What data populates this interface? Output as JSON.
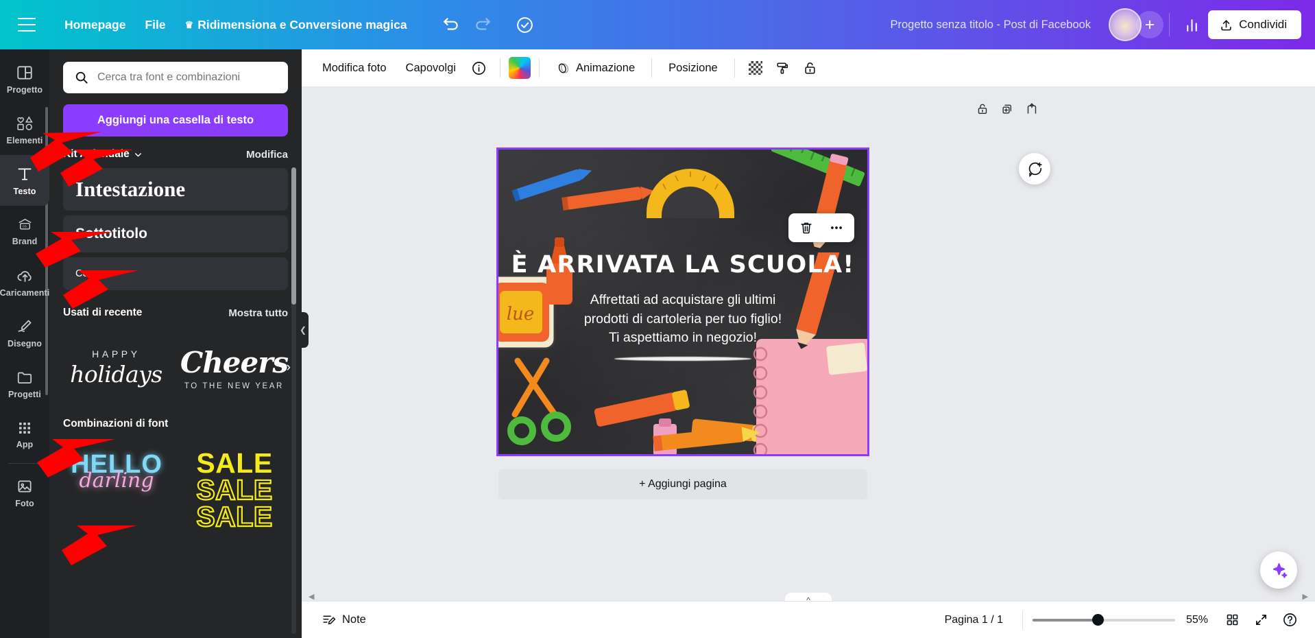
{
  "header": {
    "menu_icon": "hamburger-icon",
    "nav": [
      {
        "label": "Homepage",
        "icon": null
      },
      {
        "label": "File",
        "icon": null
      },
      {
        "label": "Ridimensiona e Conversione magica",
        "icon": "crown-icon"
      }
    ],
    "undo_icon": "undo-icon",
    "redo_icon": "redo-icon",
    "cloud_icon": "cloud-check-icon",
    "doc_title": "Progetto senza titolo - Post di Facebook",
    "add_collaborator_label": "+",
    "stats_icon": "bar-chart-icon",
    "share_label": "Condividi",
    "share_icon": "upload-icon"
  },
  "rail": {
    "items": [
      {
        "label": "Progetto",
        "icon": "layout-icon",
        "active": false
      },
      {
        "label": "Elementi",
        "icon": "shapes-icon",
        "active": false
      },
      {
        "label": "Testo",
        "icon": "text-t-icon",
        "active": true
      },
      {
        "label": "Brand",
        "icon": "brand-card-icon",
        "active": false
      },
      {
        "label": "Caricamenti",
        "icon": "upload-cloud-icon",
        "active": false
      },
      {
        "label": "Disegno",
        "icon": "pen-icon",
        "active": false
      },
      {
        "label": "Progetti",
        "icon": "folder-icon",
        "active": false
      },
      {
        "label": "App",
        "icon": "grid-dots-icon",
        "active": false
      },
      {
        "label": "Foto",
        "icon": "image-icon",
        "active": false
      }
    ]
  },
  "panel": {
    "search": {
      "placeholder": "Cerca tra font e combinazioni",
      "value": "",
      "icon": "search-icon"
    },
    "add_text_button": "Aggiungi una casella di testo",
    "brand_kit": {
      "title": "Kit Aziendale",
      "chevron": "chevron-down-icon",
      "edit_label": "Modifica"
    },
    "styles": [
      {
        "label": "Intestazione",
        "variant": "h1"
      },
      {
        "label": "Sottotitolo",
        "variant": "h2"
      },
      {
        "label": "Corpo",
        "variant": "h3"
      }
    ],
    "recent": {
      "title": "Usati di recente",
      "show_all": "Mostra tutto",
      "tiles": [
        {
          "top": "HAPPY",
          "main": "holidays",
          "bottom": ""
        },
        {
          "top": "",
          "main": "Cheers",
          "bottom": "TO THE NEW YEAR"
        }
      ]
    },
    "combos": {
      "title": "Combinazioni di font",
      "tiles": [
        {
          "line1": "HELLO",
          "line2": "darling"
        },
        {
          "line1": "SALE",
          "line2": "SALE",
          "line3": "SALE"
        }
      ]
    }
  },
  "toolbar": {
    "items": [
      {
        "label": "Modifica foto",
        "type": "text"
      },
      {
        "label": "Capovolgi",
        "type": "text"
      },
      {
        "label": "",
        "type": "icon",
        "icon": "info-icon"
      },
      {
        "label": "",
        "type": "swatch",
        "icon": "color-wheel-icon"
      },
      {
        "label": "Animazione",
        "type": "text",
        "icon": "animation-icon"
      },
      {
        "label": "Posizione",
        "type": "text"
      },
      {
        "label": "",
        "type": "icon",
        "icon": "transparency-icon"
      },
      {
        "label": "",
        "type": "icon",
        "icon": "paint-roller-icon"
      },
      {
        "label": "",
        "type": "icon",
        "icon": "lock-icon"
      }
    ]
  },
  "canvas": {
    "page_tools": [
      {
        "icon": "lock-icon"
      },
      {
        "icon": "duplicate-page-icon"
      },
      {
        "icon": "add-page-icon"
      }
    ],
    "float_toolbar": [
      {
        "icon": "trash-icon"
      },
      {
        "icon": "more-dots-icon"
      }
    ],
    "comment_icon": "comment-add-icon",
    "design": {
      "headline": "È ARRIVATA LA SCUOLA!",
      "body_lines": [
        "Affrettati ad acquistare gli ultimi",
        "prodotti di cartoleria per tuo figlio!",
        "Ti aspettiamo in negozio!"
      ],
      "glue_label": "lue"
    },
    "add_page_label": "+ Aggiungi pagina",
    "magic_icon": "magic-sparkle-icon"
  },
  "statusbar": {
    "notes_label": "Note",
    "notes_icon": "notes-icon",
    "page_indicator": "Pagina 1 / 1",
    "zoom_value": "55%",
    "grid_icon": "grid-view-icon",
    "fullscreen_icon": "fullscreen-icon",
    "help_icon": "help-icon"
  },
  "colors": {
    "brand_purple": "#8b3dff",
    "header_gradient_start": "#00c4cc",
    "header_gradient_end": "#7d2ae8",
    "annotation_red": "#ff0000"
  }
}
